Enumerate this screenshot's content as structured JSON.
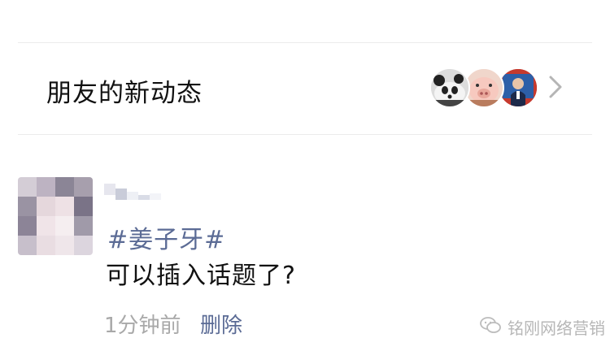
{
  "friends_updates": {
    "title": "朋友的新动态",
    "avatars": [
      "panda-avatar",
      "pig-avatar",
      "anchor-avatar"
    ],
    "chevron_icon": "chevron-right-icon"
  },
  "post": {
    "topic": "#姜子牙#",
    "text": "可以插入话题了?",
    "timestamp": "1分钟前",
    "delete_label": "删除"
  },
  "watermark": {
    "text": "铭刚网络营销",
    "icon": "wechat-official-account-icon"
  },
  "colors": {
    "link": "#5b6b95",
    "muted": "#a9a9a9",
    "divider": "#ececec"
  }
}
